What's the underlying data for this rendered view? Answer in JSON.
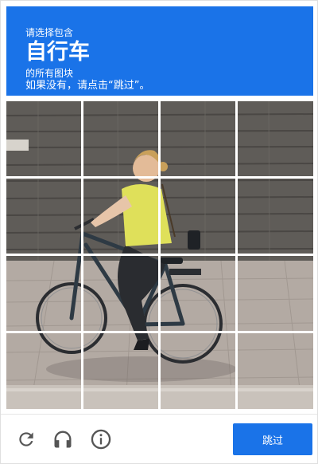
{
  "challenge": {
    "instruction_line1": "请选择包含",
    "object": "自行车",
    "instruction_line3": "的所有图块",
    "instruction_line4": "如果没有，请点击“跳过”。"
  },
  "grid": {
    "rows": 4,
    "cols": 4
  },
  "footer": {
    "reload_icon": "reload-icon",
    "audio_icon": "headphones-icon",
    "info_icon": "info-icon",
    "skip_label": "跳过"
  },
  "colors": {
    "accent": "#1a73e8",
    "icon": "#555555"
  }
}
